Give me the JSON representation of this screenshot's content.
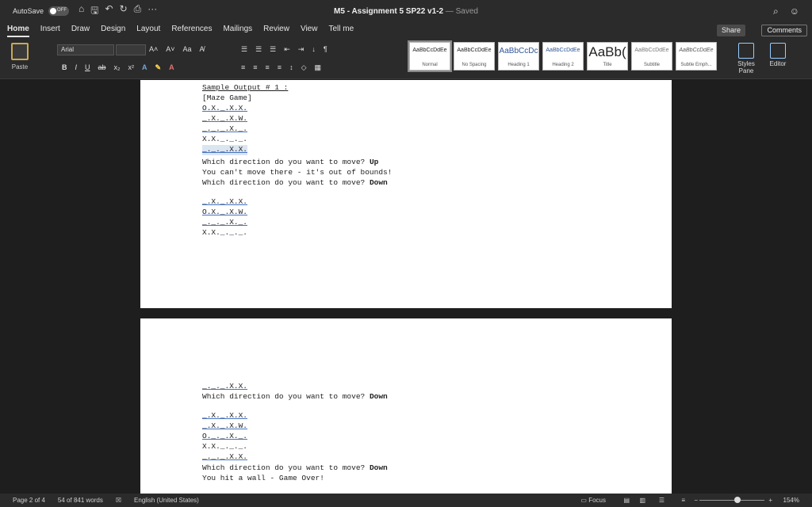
{
  "titlebar": {
    "autosave_label": "AutoSave",
    "autosave_state": "OFF",
    "title": "M5 - Assignment 5 SP22 v1-2",
    "saved": "— Saved"
  },
  "menu": {
    "tabs": [
      "Home",
      "Insert",
      "Draw",
      "Design",
      "Layout",
      "References",
      "Mailings",
      "Review",
      "View",
      "Tell me"
    ],
    "share": "Share",
    "comments": "Comments"
  },
  "ribbon": {
    "paste": "Paste",
    "font_name": "Arial",
    "styles": [
      {
        "sample": "AaBbCcDdEe",
        "label": "Normal"
      },
      {
        "sample": "AaBbCcDdEe",
        "label": "No Spacing"
      },
      {
        "sample": "AaBbCcDc",
        "label": "Heading 1"
      },
      {
        "sample": "AaBbCcDdEe",
        "label": "Heading 2"
      },
      {
        "sample": "AaBb(",
        "label": "Title"
      },
      {
        "sample": "AaBbCcDdEe",
        "label": "Subtitle"
      },
      {
        "sample": "AaBbCcDdEe",
        "label": "Subtle Emph..."
      }
    ],
    "styles_pane": "Styles Pane",
    "editor": "Editor"
  },
  "doc": {
    "page1": {
      "heading": "Sample Output # 1 :",
      "lines": [
        "[Maze Game]",
        "O.X._.X.X.",
        "_.X._.X.W.",
        "_._._.X._.",
        "X.X._._._.",
        "_._._.X.X.",
        "Which direction do you want to move? Up",
        "You can't move there - it's out of bounds!",
        "Which direction do you want to move? Down",
        "",
        "_.X._.X.X.",
        "O.X._.X.W.",
        "_._._.X._.",
        "X.X._._._."
      ]
    },
    "page2": {
      "lines": [
        "_._._.X.X.",
        "Which direction do you want to move? Down",
        "",
        "_.X._.X.X.",
        "_.X._.X.W.",
        "O._._.X._.",
        "X.X._._._.",
        "_._._.X.X.",
        "Which direction do you want to move? Down",
        "You hit a wall - Game Over!"
      ]
    }
  },
  "status": {
    "page": "Page 2 of 4",
    "words": "54 of 841 words",
    "language": "English (United States)",
    "focus": "Focus",
    "zoom": "154%"
  }
}
